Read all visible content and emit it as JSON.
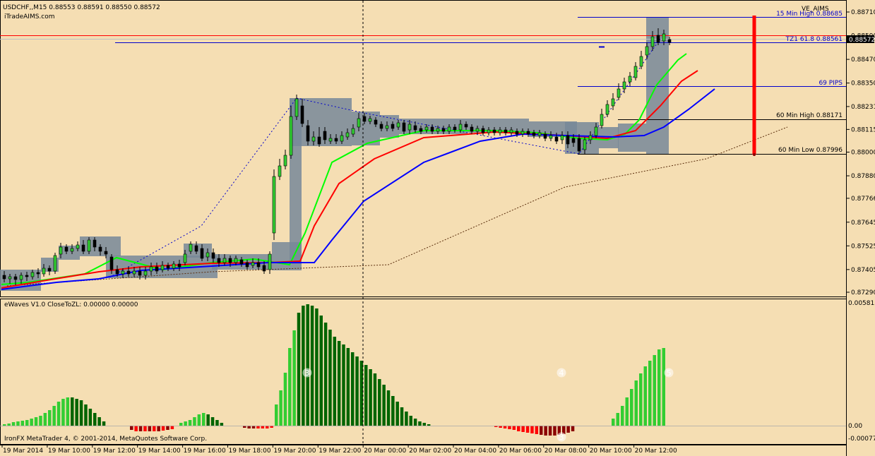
{
  "header": {
    "title": "USDCHF,,M15  0.88553 0.88591 0.88550 0.88572",
    "subtitle": "iTradeAIMS.com",
    "indicator_name": "VE_AIMS"
  },
  "colors": {
    "background": "#F5DEB3",
    "bull_candle": "#32CD32",
    "bear_candle": "#000000",
    "zone": "#778899",
    "ma_fast": "#00FF00",
    "ma_mid": "#FF0000",
    "ma_slow": "#0000FF",
    "osc_pos_bright": "#32CD32",
    "osc_pos_dark": "#006400",
    "osc_neg_bright": "#FF0000",
    "osc_neg_dark": "#8B0000",
    "level_blue": "#0000CC",
    "level_red": "#FF0000"
  },
  "levels": {
    "high15": "15 Min High  0.88685",
    "tz": "TZ1 61.8  0.88561",
    "pips": "69 PIPS",
    "high60": "60 Min High  0.88171",
    "low60": "60 Min Low  0.87996"
  },
  "price_axis": {
    "ticks": [
      "0.88710",
      "0.88590",
      "0.88470",
      "0.88350",
      "0.88231",
      "0.88115",
      "0.88000",
      "0.87880",
      "0.87766",
      "0.87645",
      "0.87525",
      "0.87405",
      "0.87290"
    ],
    "current_price": "0.88572"
  },
  "oscillator": {
    "label": "eWaves V1.0 CloseToZL: 0.00000 0.00000",
    "axis_ticks": [
      "0.005815",
      "0.00",
      "-0.000774"
    ],
    "wave_labels": [
      "3",
      "4",
      "5",
      "3"
    ]
  },
  "time_axis": [
    "19 Mar 2014",
    "19 Mar 10:00",
    "19 Mar 12:00",
    "19 Mar 14:00",
    "19 Mar 16:00",
    "19 Mar 18:00",
    "19 Mar 20:00",
    "19 Mar 22:00",
    "20 Mar 00:00",
    "20 Mar 02:00",
    "20 Mar 04:00",
    "20 Mar 06:00",
    "20 Mar 08:00",
    "20 Mar 10:00",
    "20 Mar 12:00"
  ],
  "footer": {
    "copyright": "IronFX MetaTrader 4, © 2001-2014, MetaQuotes Software Corp."
  }
}
